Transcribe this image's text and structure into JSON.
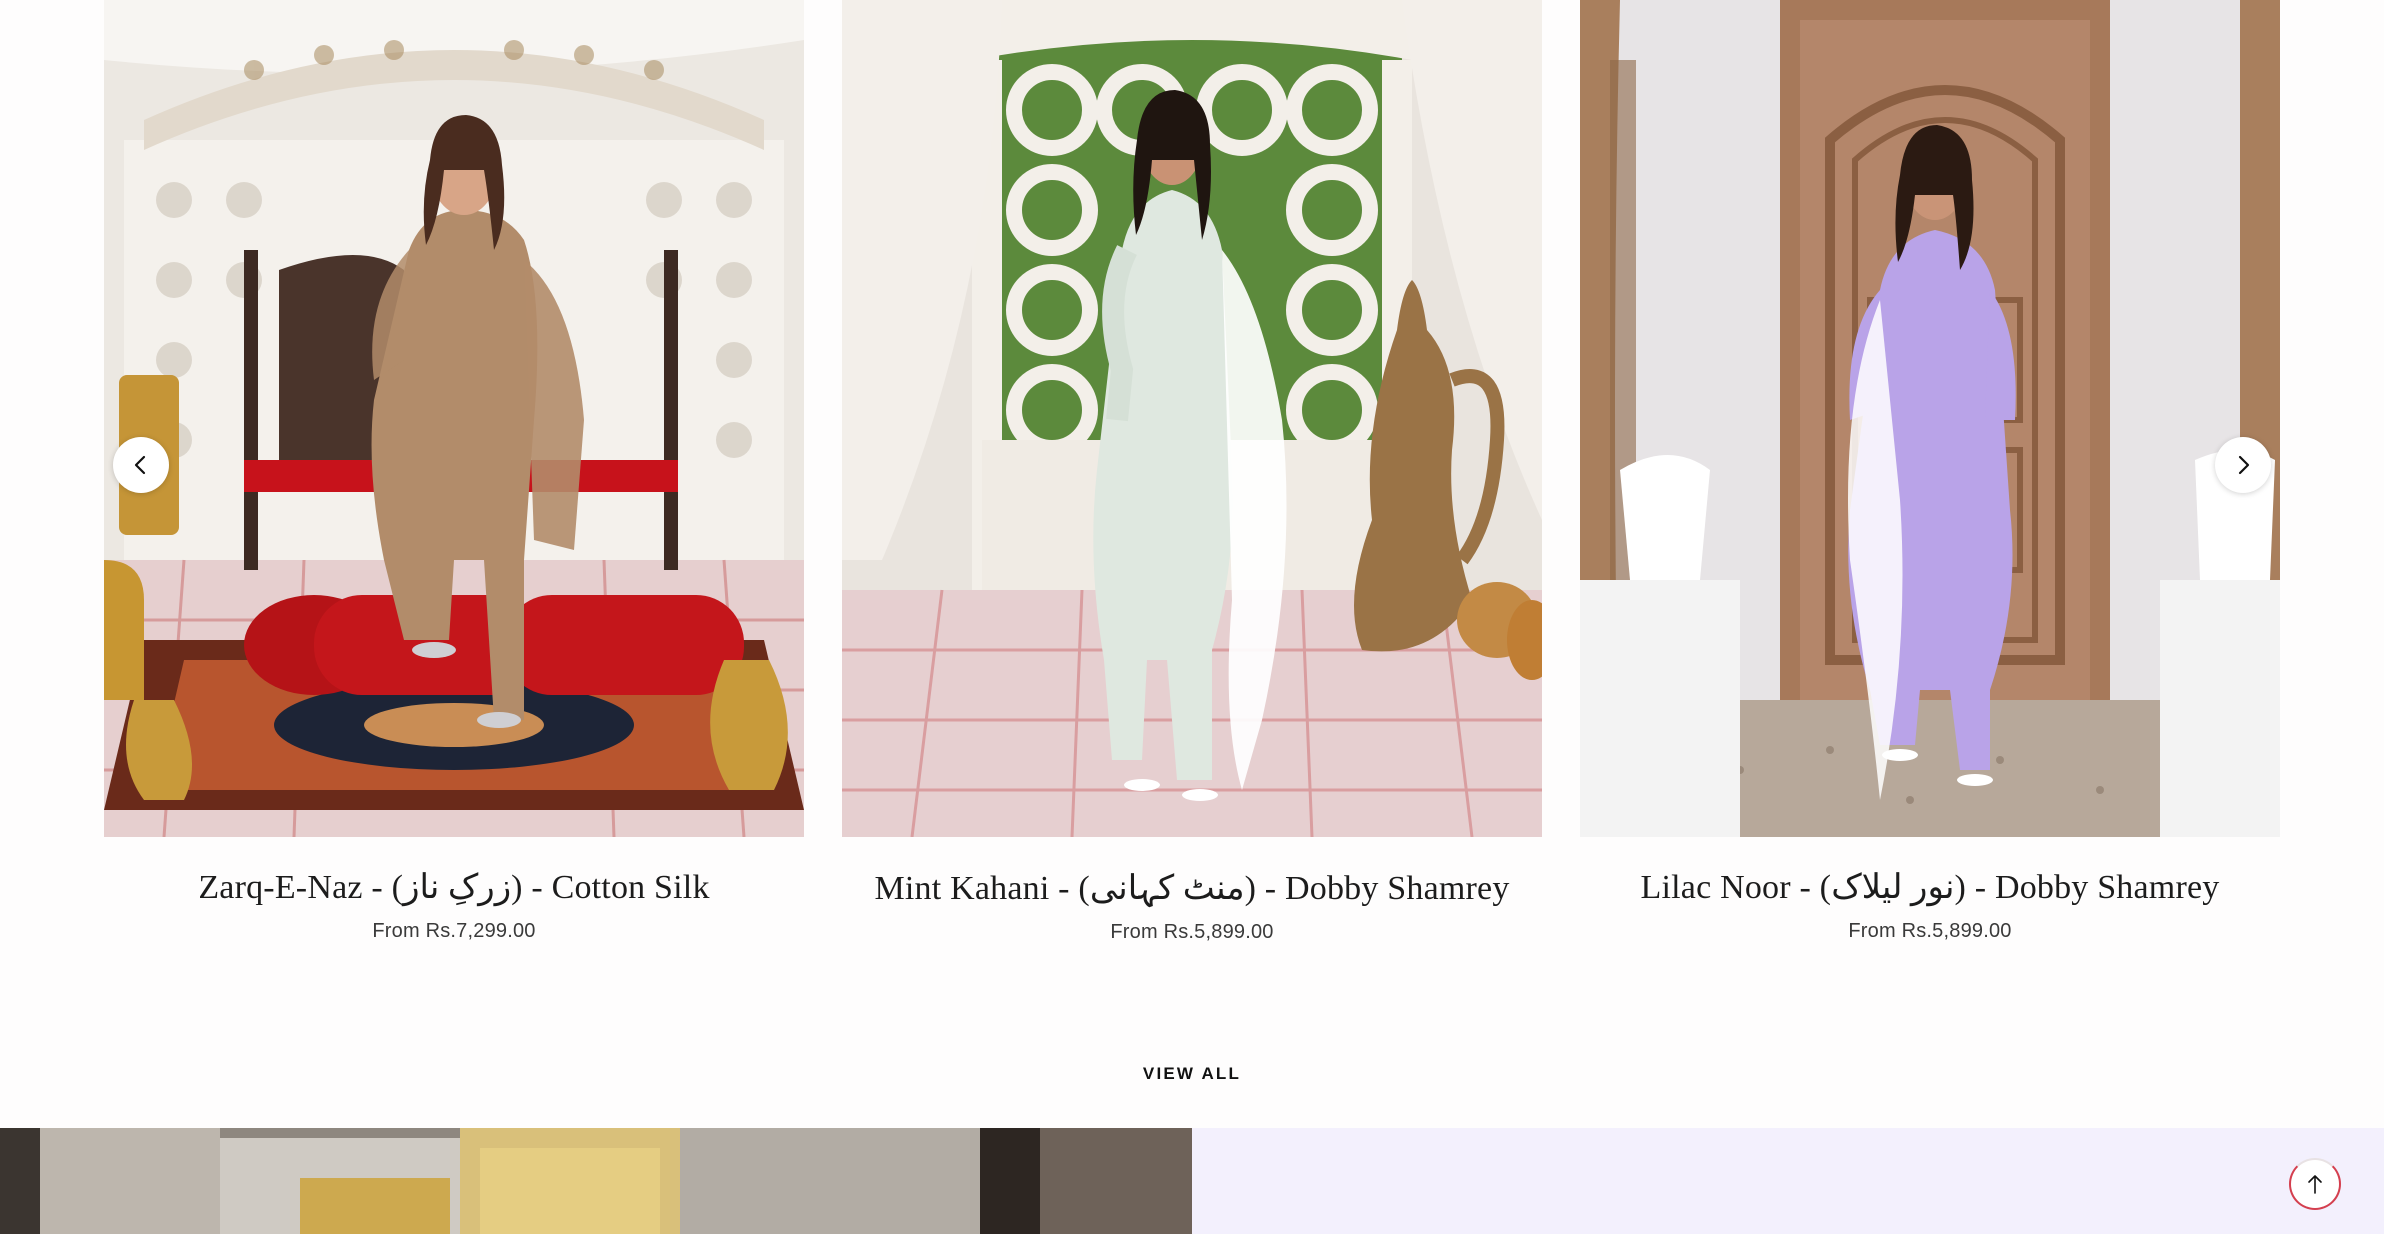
{
  "carousel": {
    "prev_icon": "chevron-left-icon",
    "next_icon": "chevron-right-icon",
    "products": [
      {
        "title": "Zarq-E-Naz - (زرکِ ناز) - Cotton Silk",
        "price": "From Rs.7,299.00",
        "outfit_color": "#b28c6a"
      },
      {
        "title": "Mint Kahani - (منٹ کہانی) - Dobby Shamrey",
        "price": "From Rs.5,899.00",
        "outfit_color": "#dfe8e0"
      },
      {
        "title": "Lilac Noor - (نور لیلاک) - Dobby Shamrey",
        "price": "From Rs.5,899.00",
        "outfit_color": "#b9a3e8"
      }
    ]
  },
  "view_all": "VIEW ALL",
  "banner": {
    "right_panel_color": "#f3f0fd"
  },
  "scroll_top": {
    "icon": "arrow-up-icon",
    "accent_color": "#d43f4f"
  }
}
